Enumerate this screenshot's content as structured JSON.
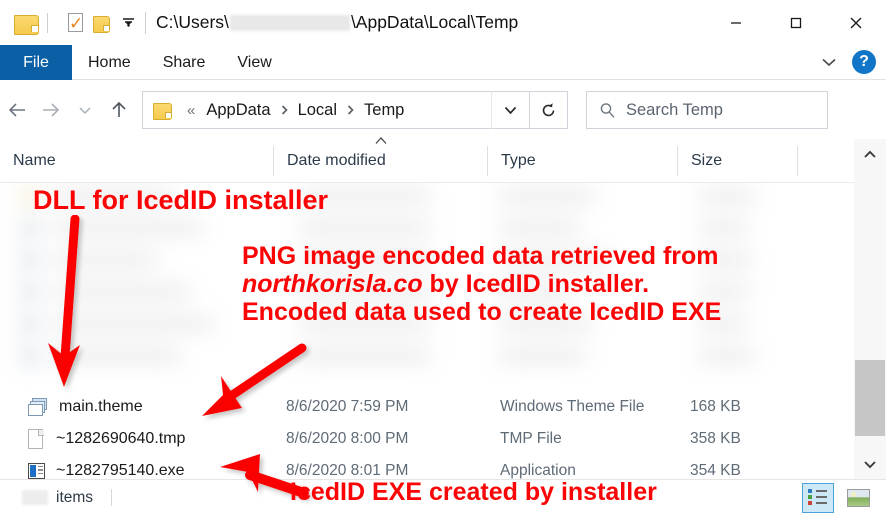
{
  "window": {
    "title_path_prefix": "C:\\Users\\",
    "title_path_suffix": "\\AppData\\Local\\Temp",
    "minimize_label": "Minimize",
    "maximize_label": "Maximize",
    "close_label": "Close"
  },
  "quick_access": {
    "folder_icon": "folder-icon",
    "properties_icon": "properties-icon",
    "new_folder_icon": "new-folder-icon",
    "customize_icon": "chevron-down-icon"
  },
  "ribbon": {
    "tabs": [
      {
        "label": "File",
        "active": true
      },
      {
        "label": "Home",
        "active": false
      },
      {
        "label": "Share",
        "active": false
      },
      {
        "label": "View",
        "active": false
      }
    ],
    "expand_icon": "chevron-down-icon",
    "help_label": "?",
    "file_tab_bg": "#0b5fa5"
  },
  "address_bar": {
    "back_icon": "arrow-left-icon",
    "forward_icon": "arrow-right-icon",
    "recent_icon": "chevron-down-icon",
    "up_icon": "arrow-up-icon",
    "folder_icon": "folder-icon",
    "overflow": "«",
    "crumbs": [
      "AppData",
      "Local",
      "Temp"
    ],
    "crumb_separator": "›",
    "dropdown_icon": "chevron-down-icon",
    "refresh_icon": "refresh-icon"
  },
  "search": {
    "icon": "search-icon",
    "placeholder": "Search Temp"
  },
  "columns": [
    {
      "label": "Name",
      "sorted": false
    },
    {
      "label": "Date modified",
      "sorted": true,
      "sort_dir": "asc"
    },
    {
      "label": "Type",
      "sorted": false
    },
    {
      "label": "Size",
      "sorted": false
    }
  ],
  "files": [
    {
      "name": "main.theme",
      "date": "8/6/2020 7:59 PM",
      "type": "Windows Theme File",
      "size": "168 KB",
      "icon": "theme-file-icon"
    },
    {
      "name": "~1282690640.tmp",
      "date": "8/6/2020 8:00 PM",
      "type": "TMP File",
      "size": "358 KB",
      "icon": "generic-file-icon"
    },
    {
      "name": "~1282795140.exe",
      "date": "8/6/2020 8:01 PM",
      "type": "Application",
      "size": "354 KB",
      "icon": "application-icon"
    }
  ],
  "status_bar": {
    "items_label": "items",
    "count_redacted": true,
    "details_view_icon": "details-view-icon",
    "large_icons_view_icon": "large-icons-view-icon",
    "details_view_selected": true
  },
  "scrollbar": {
    "up_icon": "chevron-up-icon",
    "down_icon": "chevron-down-icon"
  },
  "annotations": {
    "color": "#fb0405",
    "dll": "DLL for IcedID installer",
    "png_line1": "PNG image encoded data retrieved from",
    "png_line2_domain": "northkorisla.co",
    "png_line2_rest": " by IcedID installer.",
    "png_line3": "Encoded data used to create IcedID EXE",
    "exe": "IcedID EXE created by installer",
    "arrows": [
      {
        "name": "arrow-to-main-theme",
        "direction": "down"
      },
      {
        "name": "arrow-to-tmp-file",
        "direction": "down-left"
      },
      {
        "name": "arrow-to-exe-file",
        "direction": "left"
      }
    ]
  }
}
